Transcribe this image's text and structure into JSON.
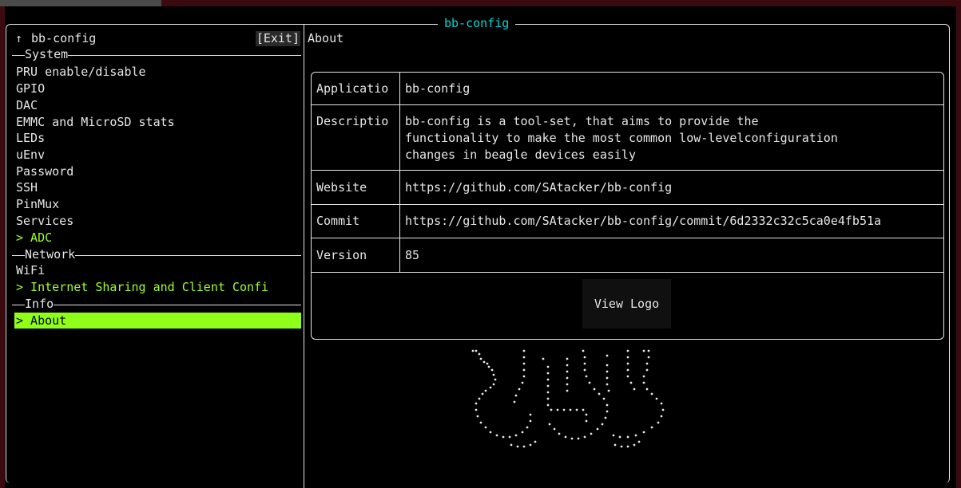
{
  "window": {
    "title": "bb-config"
  },
  "sidebar": {
    "up_arrow": "↑",
    "title": "bb-config",
    "exit_label": "[Exit]",
    "sections": [
      {
        "label": "System"
      },
      {
        "label": "Network"
      },
      {
        "label": "Info"
      }
    ],
    "items": [
      {
        "label": "PRU enable/disable"
      },
      {
        "label": "GPIO"
      },
      {
        "label": "DAC"
      },
      {
        "label": "EMMC and MicroSD stats"
      },
      {
        "label": "LEDs"
      },
      {
        "label": "uEnv"
      },
      {
        "label": "Password"
      },
      {
        "label": "SSH"
      },
      {
        "label": "PinMux"
      },
      {
        "label": "Services"
      },
      {
        "label": "> ADC"
      },
      {
        "label": "WiFi"
      },
      {
        "label": "> Internet Sharing and Client Confi"
      },
      {
        "label": "> About"
      }
    ]
  },
  "about": {
    "header": "About",
    "rows": [
      {
        "key": "Applicatio",
        "value": "bb-config"
      },
      {
        "key": "Descriptio",
        "value": "bb-config is a tool-set, that aims to provide the\nfunctionality to make the most common low-levelconfiguration\nchanges in beagle devices easily"
      },
      {
        "key": "Website",
        "value": "https://github.com/SAtacker/bb-config"
      },
      {
        "key": "Commit",
        "value": "https://github.com/SAtacker/bb-config/commit/6d2332c32c5ca0e4fb51a"
      },
      {
        "key": "Version",
        "value": "85"
      }
    ],
    "view_logo_label": "View Logo"
  },
  "colors": {
    "title_accent": "#00d7d7",
    "highlight_text": "#9fff2a",
    "selected_bg": "#8fff1a"
  }
}
